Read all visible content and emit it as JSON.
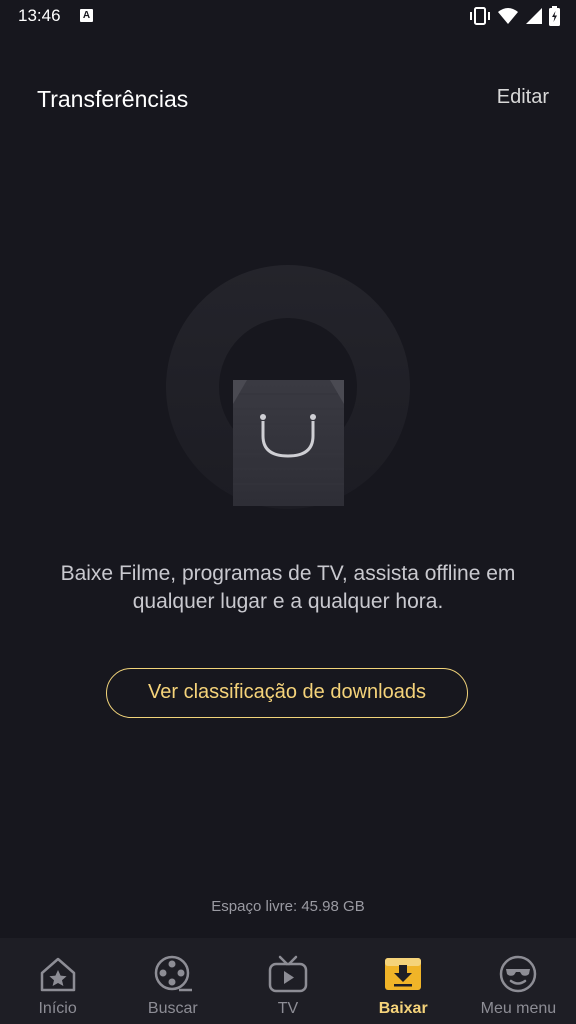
{
  "status_bar": {
    "time": "13:46",
    "notification_icon": "a-icon",
    "icons": [
      "vibrate-icon",
      "wifi-icon",
      "cellular-icon",
      "battery-charging-icon"
    ]
  },
  "header": {
    "title": "Transferências",
    "edit_label": "Editar"
  },
  "empty_state": {
    "illustration_icon": "shopping-bag-icon",
    "message": "Baixe Filme, programas de TV, assista offline em qualquer lugar e a qualquer hora.",
    "cta_label": "Ver classificação de downloads"
  },
  "storage": {
    "free_space_label": "Espaço livre: 45.98 GB"
  },
  "bottom_nav": {
    "items": [
      {
        "label": "Início",
        "icon": "home-star-icon",
        "active": false
      },
      {
        "label": "Buscar",
        "icon": "film-reel-icon",
        "active": false
      },
      {
        "label": "TV",
        "icon": "tv-play-icon",
        "active": false
      },
      {
        "label": "Baixar",
        "icon": "download-icon",
        "active": true
      },
      {
        "label": "Meu menu",
        "icon": "sunglasses-face-icon",
        "active": false
      }
    ]
  },
  "colors": {
    "background": "#17171e",
    "accent": "#f5d37a",
    "nav_background": "#1e1e25"
  }
}
